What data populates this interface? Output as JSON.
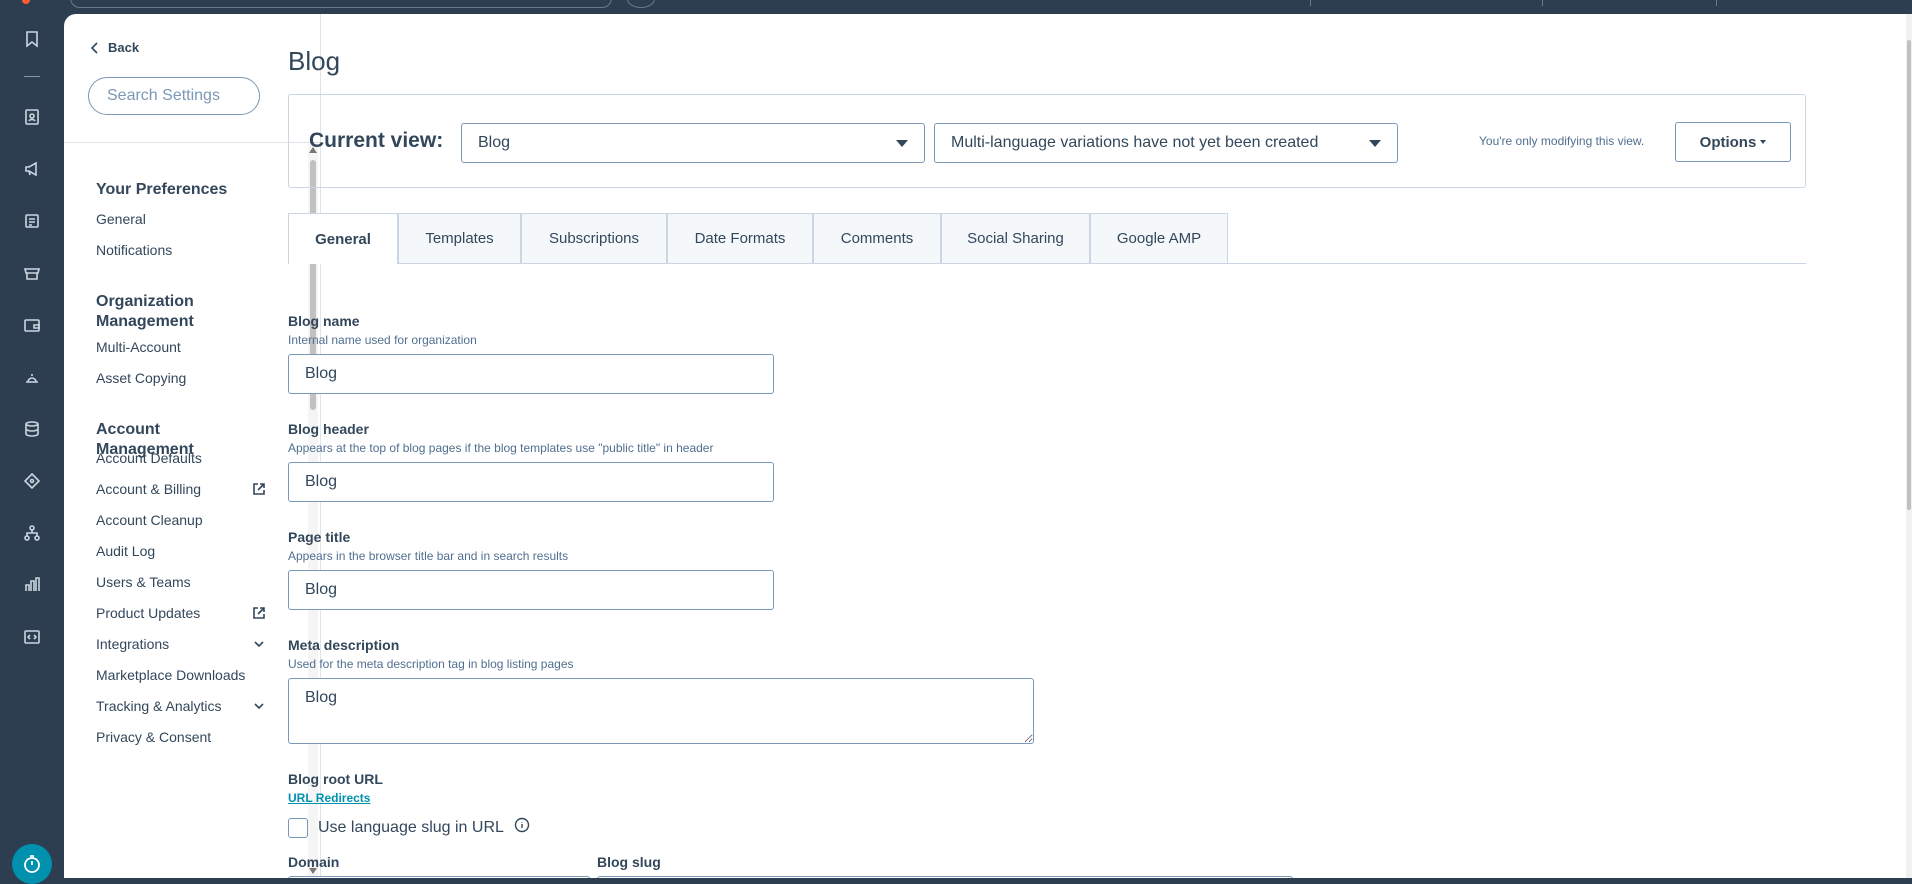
{
  "sidebar": {
    "back_label": "Back",
    "search_placeholder": "Search Settings",
    "groups": [
      {
        "title": "Your Preferences",
        "items": [
          "General",
          "Notifications"
        ]
      },
      {
        "title": "Organization Management",
        "items": [
          "Multi-Account",
          "Asset Copying"
        ]
      },
      {
        "title": "Account Management",
        "items": [
          "Account Defaults",
          "Account & Billing",
          "Account Cleanup",
          "Audit Log",
          "Users & Teams",
          "Product Updates",
          "Integrations",
          "Marketplace Downloads",
          "Tracking & Analytics",
          "Privacy & Consent"
        ]
      }
    ]
  },
  "rail": {
    "icons": [
      "bookmark-icon",
      "contacts-icon",
      "marketing-icon",
      "content-icon",
      "commerce-icon",
      "sales-icon",
      "service-icon",
      "data-icon",
      "automation-icon",
      "org-chart-icon",
      "reports-icon",
      "developer-icon"
    ],
    "timer_icon": "timer-icon"
  },
  "main": {
    "title": "Blog",
    "current_view_label": "Current view:",
    "view_select": "Blog",
    "language_select": "Multi-language variations have not yet been created",
    "modify_note": "You're only modifying this view.",
    "options_label": "Options",
    "tabs": [
      "General",
      "Templates",
      "Subscriptions",
      "Date Formats",
      "Comments",
      "Social Sharing",
      "Google AMP"
    ],
    "active_tab": "General",
    "fields": {
      "blog_name": {
        "label": "Blog name",
        "help": "Internal name used for organization",
        "value": "Blog"
      },
      "blog_header": {
        "label": "Blog header",
        "help": "Appears at the top of blog pages if the blog templates use \"public title\" in header",
        "value": "Blog"
      },
      "page_title": {
        "label": "Page title",
        "help": "Appears in the browser title bar and in search results",
        "value": "Blog"
      },
      "meta_description": {
        "label": "Meta description",
        "help": "Used for the meta description tag in blog listing pages",
        "value": "Blog"
      },
      "blog_root_url": {
        "label": "Blog root URL",
        "link": "URL Redirects",
        "checkbox_label": "Use language slug in URL"
      },
      "domain": {
        "label": "Domain"
      },
      "blog_slug": {
        "label": "Blog slug"
      }
    }
  },
  "colors": {
    "rail": "#2d3e50",
    "accent": "#0091ae",
    "text": "#33475b"
  }
}
